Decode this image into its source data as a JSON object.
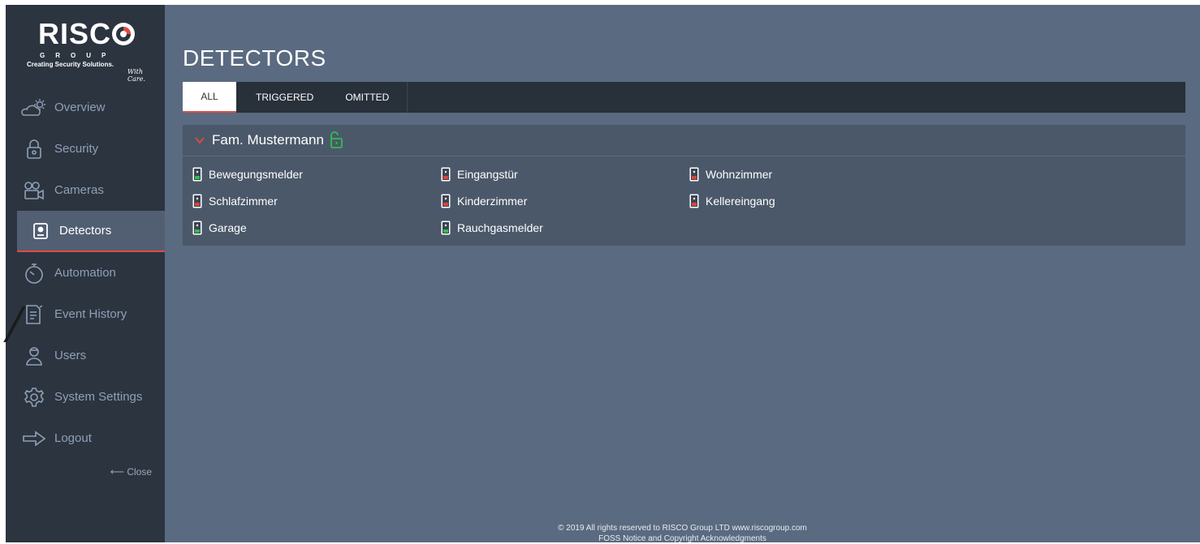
{
  "brand": {
    "name": "RISC",
    "group": "GROUP",
    "tagline": "Creating Security Solutions.",
    "subline": "With Care."
  },
  "nav": {
    "items": [
      {
        "label": "Overview",
        "icon": "cloud-sun-icon"
      },
      {
        "label": "Security",
        "icon": "lock-icon"
      },
      {
        "label": "Cameras",
        "icon": "camera-icon"
      },
      {
        "label": "Detectors",
        "icon": "detector-icon",
        "active": true
      },
      {
        "label": "Automation",
        "icon": "timer-icon"
      },
      {
        "label": "Event History",
        "icon": "document-icon"
      },
      {
        "label": "Users",
        "icon": "user-icon"
      },
      {
        "label": "System Settings",
        "icon": "gear-icon"
      },
      {
        "label": "Logout",
        "icon": "arrow-right-icon"
      }
    ],
    "close_label": "⟵ Close"
  },
  "page": {
    "title": "DETECTORS"
  },
  "tabs": [
    {
      "label": "ALL",
      "active": true
    },
    {
      "label": "TRIGGERED"
    },
    {
      "label": "OMITTED"
    }
  ],
  "group": {
    "name": "Fam. Mustermann",
    "lock_state": "unlocked",
    "detectors": [
      {
        "name": "Bewegungsmelder",
        "status": "green"
      },
      {
        "name": "Eingangstür",
        "status": "red"
      },
      {
        "name": "Wohnzimmer",
        "status": "red"
      },
      {
        "name": "Schlafzimmer",
        "status": "red"
      },
      {
        "name": "Kinderzimmer",
        "status": "red"
      },
      {
        "name": "Kellereingang",
        "status": "red"
      },
      {
        "name": "Garage",
        "status": "green"
      },
      {
        "name": "Rauchgasmelder",
        "status": "green"
      }
    ]
  },
  "footer": {
    "line1": "© 2019 All rights reserved to RISCO Group LTD  www.riscogroup.com",
    "line2": "FOSS Notice and Copyright Acknowledgments"
  },
  "colors": {
    "accent": "#e04b3f",
    "status_green": "#2fbf4f",
    "status_red": "#e0413a",
    "sidebar_bg": "#2c3440",
    "main_bg": "#5a6a80"
  }
}
